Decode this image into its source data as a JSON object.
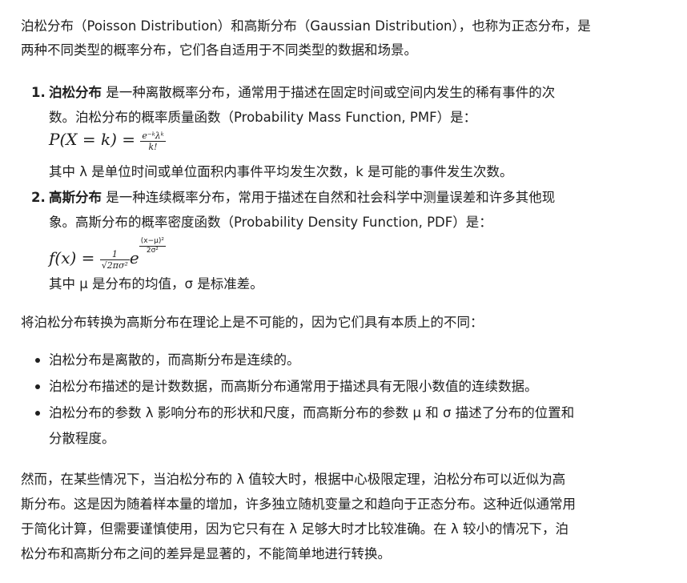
{
  "intro": {
    "line1": "泊松分布（Poisson Distribution）和高斯分布（Gaussian Distribution），也称为正态分布，是",
    "line2": "两种不同类型的概率分布，它们各自适用于不同类型的数据和场景。"
  },
  "items": [
    {
      "number": "1.",
      "term": "泊松分布",
      "desc1": " 是一种离散概率分布，通常用于描述在固定时间或空间内发生的稀有事件的次",
      "desc2": "数。泊松分布的概率质量函数（Probability Mass Function, PMF）是：",
      "formula_lhs": "P(X = k) = ",
      "formula_num": "e⁻ᵏλᵏ",
      "formula_den": "k!",
      "note": "其中 λ 是单位时间或单位面积内事件平均发生次数，k 是可能的事件发生次数。"
    },
    {
      "number": "2.",
      "term": "高斯分布",
      "desc1": " 是一种连续概率分布，常用于描述在自然和社会科学中测量误差和许多其他现",
      "desc2": "象。高斯分布的概率密度函数（Probability Density Function, PDF）是：",
      "formula_lhs": "f(x) = ",
      "formula_num": "1",
      "formula_den": "√2πσ²",
      "formula_exp_num": "(x−μ)²",
      "formula_exp_den": "2σ²",
      "note": "其中 μ 是分布的均值，σ 是标准差。"
    }
  ],
  "transition": "将泊松分布转换为高斯分布在理论上是不可能的，因为它们具有本质上的不同：",
  "bullets": [
    {
      "text": "泊松分布是离散的，而高斯分布是连续的。"
    },
    {
      "text": "泊松分布描述的是计数数据，而高斯分布通常用于描述具有无限小数值的连续数据。"
    },
    {
      "line1": "泊松分布的参数 λ 影响分布的形状和尺度，而高斯分布的参数 μ 和 σ 描述了分布的位置和",
      "line2": "分散程度。"
    }
  ],
  "conclusion": {
    "line1": "然而，在某些情况下，当泊松分布的 λ 值较大时，根据中心极限定理，泊松分布可以近似为高",
    "line2": "斯分布。这是因为随着样本量的增加，许多独立随机变量之和趋向于正态分布。这种近似通常用",
    "line3": "于简化计算，但需要谨慎使用，因为它只有在 λ 足够大时才比较准确。在 λ 较小的情况下，泊",
    "line4": "松分布和高斯分布之间的差异是显著的，不能简单地进行转换。"
  }
}
